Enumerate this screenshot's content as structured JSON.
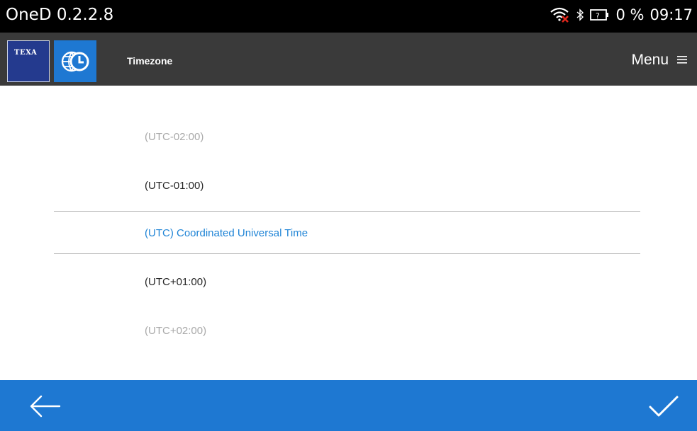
{
  "statusbar": {
    "title": "OneD 0.2.2.8",
    "battery_text": "0 %",
    "time": "09:17",
    "icons": [
      "wifi-no-internet-icon",
      "bluetooth-icon",
      "battery-unknown-icon"
    ]
  },
  "appbar": {
    "logo_text": "TEXA",
    "title": "Timezone",
    "menu_label": "Menu",
    "icons": [
      "texa-logo",
      "timezone-globe-clock-icon",
      "hamburger-menu-icon"
    ]
  },
  "timezones": {
    "items": [
      "(UTC-02:00)",
      "(UTC-01:00)",
      "(UTC) Coordinated Universal Time",
      "(UTC+01:00)",
      "(UTC+02:00)"
    ],
    "selected": "(UTC) Coordinated Universal Time"
  },
  "bottombar": {
    "icons": [
      "back-arrow-icon",
      "confirm-check-icon"
    ]
  },
  "colors": {
    "statusbar_bg": "#000000",
    "appbar_bg": "#3a3a3a",
    "accent_blue": "#1e78d2",
    "selected_text": "#1f84d6",
    "texa_blue": "#243a8e"
  }
}
